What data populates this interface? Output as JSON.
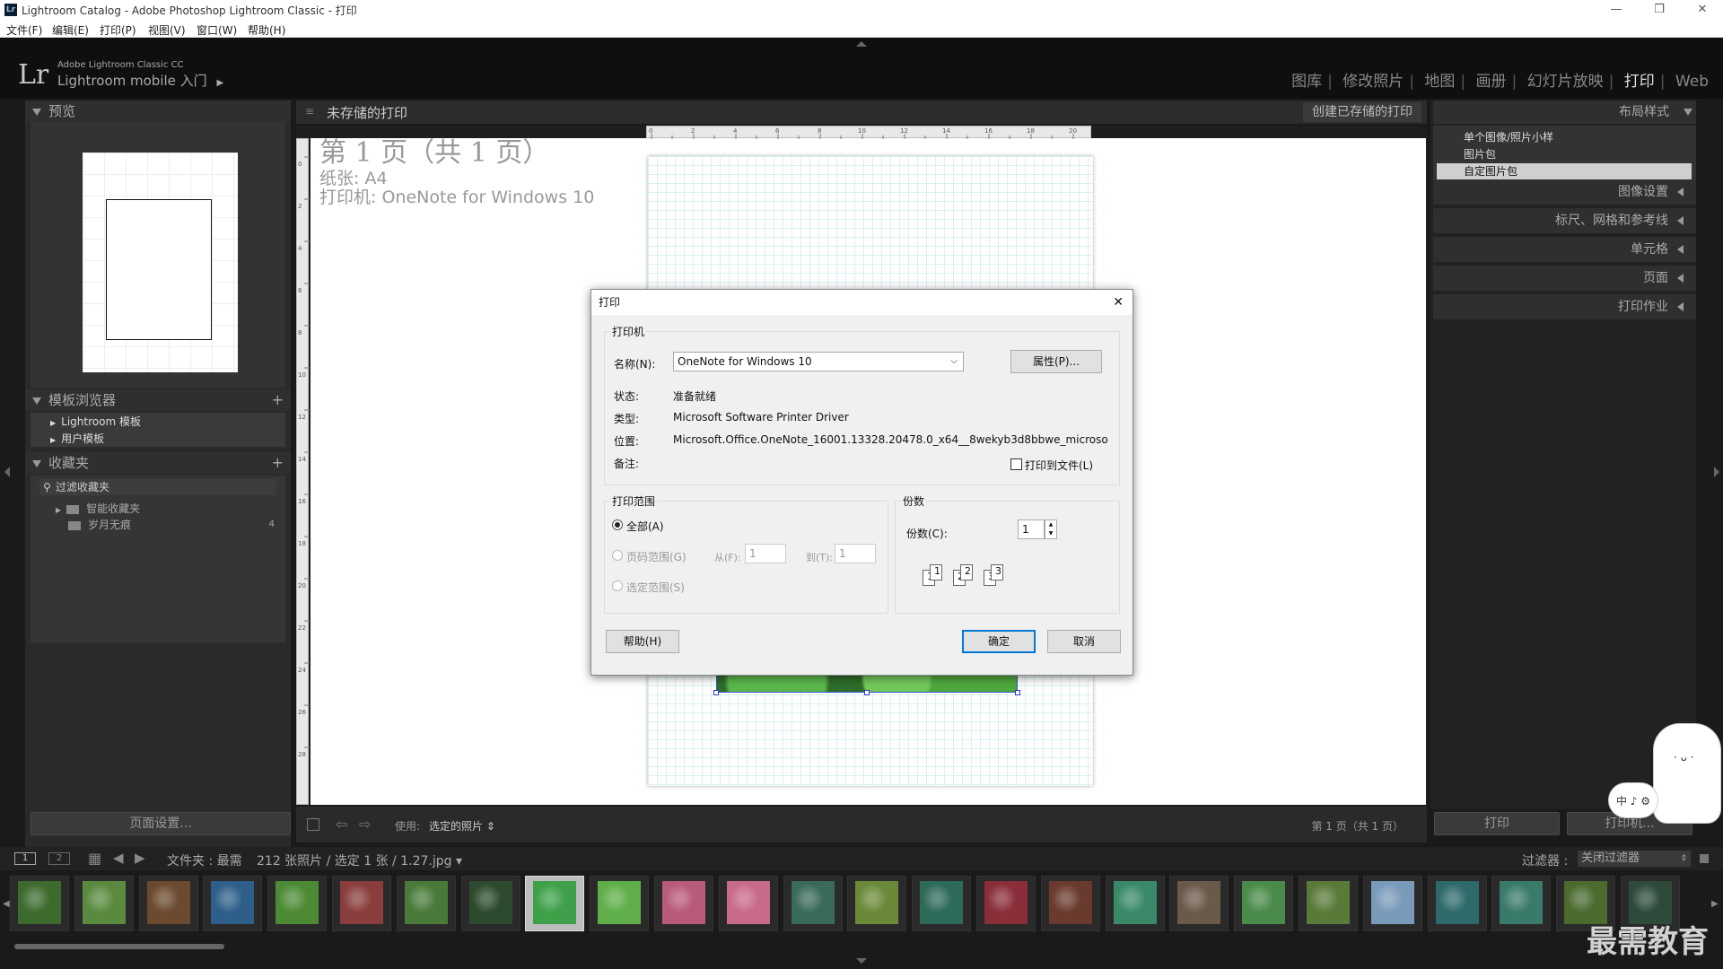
{
  "window": {
    "title": "Lightroom Catalog - Adobe Photoshop Lightroom Classic - 打印",
    "min": "—",
    "max": "❐",
    "close": "✕"
  },
  "menu": [
    "文件(F)",
    "编辑(E)",
    "打印(P)",
    "视图(V)",
    "窗口(W)",
    "帮助(H)"
  ],
  "brand": {
    "logo": "Lr",
    "line1": "Adobe Lightroom Classic CC",
    "line2": "Lightroom mobile 入门",
    "arrow": "▶"
  },
  "modules": [
    {
      "label": "图库",
      "active": false
    },
    {
      "label": "修改照片",
      "active": false
    },
    {
      "label": "地图",
      "active": false
    },
    {
      "label": "画册",
      "active": false
    },
    {
      "label": "幻灯片放映",
      "active": false
    },
    {
      "label": "打印",
      "active": true
    },
    {
      "label": "Web",
      "active": false
    }
  ],
  "left": {
    "preview_title": "预览",
    "templates_title": "模板浏览器",
    "templates_add": "+",
    "templates": [
      "Lightroom 模板",
      "用户模板"
    ],
    "collections_title": "收藏夹",
    "collections_add": "+",
    "filter_placeholder": "过滤收藏夹",
    "collections": [
      {
        "label": "智能收藏夹",
        "count": ""
      },
      {
        "label": "岁月无痕",
        "count": "4"
      }
    ],
    "page_setup": "页面设置..."
  },
  "center": {
    "header": "未存储的打印",
    "save_button": "创建已存储的打印",
    "page_info": {
      "line1": "第 1 页（共 1 页）",
      "line2": "纸张: A4",
      "line3": "打印机: OneNote for Windows 10"
    },
    "ruler_top": [
      "0",
      "2",
      "4",
      "6",
      "8",
      "10",
      "12",
      "14",
      "16",
      "18",
      "20"
    ],
    "ruler_left": [
      "0",
      "2",
      "4",
      "6",
      "8",
      "10",
      "12",
      "14",
      "16",
      "18",
      "20",
      "22",
      "24",
      "26",
      "28"
    ],
    "toolbar": {
      "use_label": "使用:",
      "use_value": "选定的照片",
      "page_count": "第 1 页（共 1 页）"
    }
  },
  "right": {
    "layout_style": "布局样式",
    "layout_options": [
      {
        "label": "单个图像/照片小样",
        "selected": false
      },
      {
        "label": "图片包",
        "selected": false
      },
      {
        "label": "自定图片包",
        "selected": true
      }
    ],
    "sections": [
      "图像设置",
      "标尺、网格和参考线",
      "单元格",
      "页面",
      "打印作业"
    ],
    "print_button": "打印",
    "printer_button": "打印机..."
  },
  "dialog": {
    "title": "打印",
    "close": "✕",
    "printer_group": "打印机",
    "name_label": "名称(N):",
    "name_value": "OneNote for Windows 10",
    "properties": "属性(P)...",
    "status_label": "状态:",
    "status_value": "准备就绪",
    "type_label": "类型:",
    "type_value": "Microsoft Software Printer Driver",
    "where_label": "位置:",
    "where_value": "Microsoft.Office.OneNote_16001.13328.20478.0_x64__8wekyb3d8bbwe_microso",
    "comment_label": "备注:",
    "print_to_file": "打印到文件(L)",
    "range_group": "打印范围",
    "all": "全部(A)",
    "pages": "页码范围(G)",
    "from_label": "从(F):",
    "from_value": "1",
    "to_label": "到(T):",
    "to_value": "1",
    "selection": "选定范围(S)",
    "copies_group": "份数",
    "copies_label": "份数(C):",
    "copies_value": "1",
    "collate_nums": [
      "1",
      "1",
      "2",
      "2",
      "3",
      "3"
    ],
    "help": "帮助(H)",
    "ok": "确定",
    "cancel": "取消"
  },
  "filmbar": {
    "view1": "1",
    "view2": "2",
    "breadcrumb": "文件夹 : 最需",
    "count": "212 张照片 / 选定 1 张 / 1.27.jpg",
    "filter_label": "过滤器 :",
    "filter_value": "关闭过滤器"
  },
  "ime": {
    "text": "中 ♪ ⚙"
  },
  "watermark": "最需教育",
  "colors": {
    "accent": "#0078d7",
    "panel": "#2a2a2a",
    "selected": "#cfcfcf"
  }
}
